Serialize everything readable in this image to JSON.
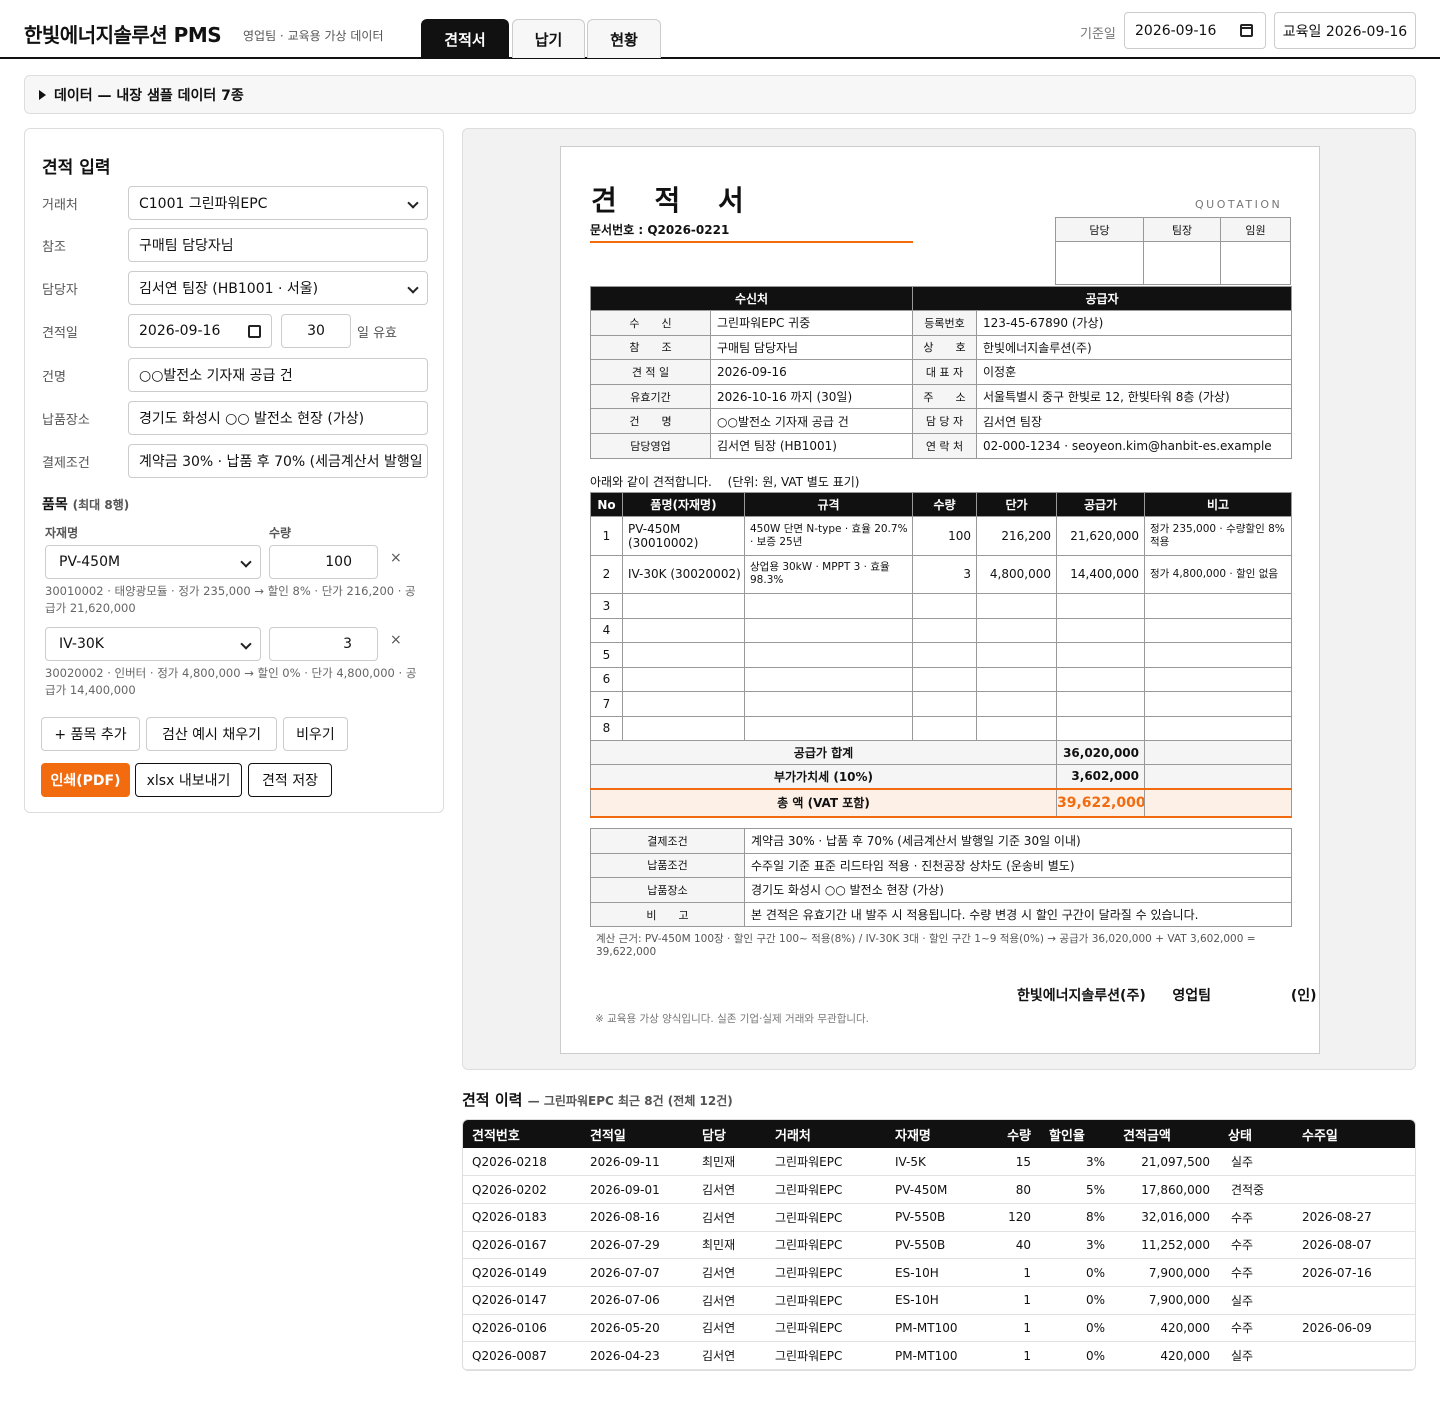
{
  "header": {
    "brand": "한빛에너지솔루션 PMS",
    "brand_sub": "영업팀 · 교육용 가상 데이터",
    "tabs": [
      "견적서",
      "납기",
      "현황"
    ],
    "base_date_label": "기준일",
    "base_date": "2026-09-16",
    "edu_date_button": "교육일 2026-09-16"
  },
  "databar": {
    "label": "데이터 — 내장 샘플 데이터 7종"
  },
  "form": {
    "title": "견적 입력",
    "customer_label": "거래처",
    "customer": "C1001 그린파워EPC",
    "ref_label": "참조",
    "ref": "구매팀 담당자님",
    "rep_label": "담당자",
    "rep": "김서연 팀장 (HB1001 · 서울)",
    "date_label": "견적일",
    "date": "2026-09-16",
    "valid_days": "30",
    "valid_suffix": "일 유효",
    "subject_label": "건명",
    "subject": "○○발전소 기자재 공급 건",
    "delivery_label": "납품장소",
    "delivery": "경기도 화성시 ○○ 발전소 현장 (가상)",
    "payment_label": "결제조건",
    "payment": "계약금 30% · 납품 후 70% (세금계산서 발행일 기준 30일 이내)",
    "items_title": "품목",
    "items_note": "(최대 8행)",
    "col_material": "자재명",
    "col_qty": "수량",
    "items": [
      {
        "name": "PV-450M",
        "qty": "100",
        "meta": "30010002 · 태양광모듈 · 정가 235,000 → 할인 8% · 단가 216,200 · 공급가 21,620,000"
      },
      {
        "name": "IV-30K",
        "qty": "3",
        "meta": "30020002 · 인버터 · 정가 4,800,000 → 할인 0% · 단가 4,800,000 · 공급가 14,400,000"
      }
    ],
    "remove_glyph": "×",
    "add_button": "+ 품목 추가",
    "sample_button": "검산 예시 채우기",
    "clear_button": "비우기",
    "print_button": "인쇄(PDF)",
    "export_button": "xlsx 내보내기",
    "save_button": "견적 저장"
  },
  "quote": {
    "title": "견 적 서",
    "title_en": "QUOTATION",
    "doc_no": "문서번호 : Q2026-0221",
    "approval": [
      "담당",
      "팀장",
      "임원"
    ],
    "recipient_header": "수신처",
    "supplier_header": "공급자",
    "recipient": [
      {
        "label": "수　　신",
        "value": "그린파워EPC 귀중"
      },
      {
        "label": "참　　조",
        "value": "구매팀 담당자님"
      },
      {
        "label": "견 적 일",
        "value": "2026-09-16"
      },
      {
        "label": "유효기간",
        "value": "2026-10-16 까지 (30일)"
      },
      {
        "label": "건　　명",
        "value": "○○발전소 기자재 공급 건"
      },
      {
        "label": "담당영업",
        "value": "김서연 팀장 (HB1001)"
      }
    ],
    "supplier": [
      {
        "label": "등록번호",
        "value": "123-45-67890 (가상)"
      },
      {
        "label": "상　　호",
        "value": "한빛에너지솔루션(주)"
      },
      {
        "label": "대 표 자",
        "value": "이정훈"
      },
      {
        "label": "주　　소",
        "value": "서울특별시 중구 한빛로 12, 한빛타워 8층 (가상)"
      },
      {
        "label": "담 당 자",
        "value": "김서연 팀장"
      },
      {
        "label": "연 락 처",
        "value": "02-000-1234 · seoyeon.kim@hanbit-es.example"
      }
    ],
    "intro": "아래와 같이 견적합니다.　 (단위: 원, VAT 별도 표기)",
    "item_headers": [
      "No",
      "품명(자재명)",
      "규격",
      "수량",
      "단가",
      "공급가",
      "비고"
    ],
    "items": [
      {
        "no": "1",
        "name": "PV-450M (30010002)",
        "spec": "450W 단면 N-type · 효율 20.7% · 보증 25년",
        "qty": "100",
        "price": "216,200",
        "amount": "21,620,000",
        "note": "정가 235,000 · 수량할인 8% 적용"
      },
      {
        "no": "2",
        "name": "IV-30K (30020002)",
        "spec": "상업용 30kW · MPPT 3 · 효율 98.3%",
        "qty": "3",
        "price": "4,800,000",
        "amount": "14,400,000",
        "note": "정가 4,800,000 · 할인 없음"
      },
      {
        "no": "3",
        "name": "",
        "spec": "",
        "qty": "",
        "price": "",
        "amount": "",
        "note": ""
      },
      {
        "no": "4",
        "name": "",
        "spec": "",
        "qty": "",
        "price": "",
        "amount": "",
        "note": ""
      },
      {
        "no": "5",
        "name": "",
        "spec": "",
        "qty": "",
        "price": "",
        "amount": "",
        "note": ""
      },
      {
        "no": "6",
        "name": "",
        "spec": "",
        "qty": "",
        "price": "",
        "amount": "",
        "note": ""
      },
      {
        "no": "7",
        "name": "",
        "spec": "",
        "qty": "",
        "price": "",
        "amount": "",
        "note": ""
      },
      {
        "no": "8",
        "name": "",
        "spec": "",
        "qty": "",
        "price": "",
        "amount": "",
        "note": ""
      }
    ],
    "subtotal_label": "공급가 합계",
    "subtotal": "36,020,000",
    "vat_label": "부가가치세 (10%)",
    "vat": "3,602,000",
    "total_label": "총 액 (VAT 포함)",
    "total": "39,622,000",
    "terms": [
      {
        "label": "결제조건",
        "value": "계약금 30% · 납품 후 70% (세금계산서 발행일 기준 30일 이내)"
      },
      {
        "label": "납품조건",
        "value": "수주일 기준 표준 리드타임 적용 · 진천공장 상차도 (운송비 별도)"
      },
      {
        "label": "납품장소",
        "value": "경기도 화성시 ○○ 발전소 현장 (가상)"
      },
      {
        "label": "비　　고",
        "value": "본 견적은 유효기간 내 발주 시 적용됩니다. 수량 변경 시 할인 구간이 달라질 수 있습니다."
      }
    ],
    "calc_note": "계산 근거: PV-450M 100장 · 할인 구간 100~ 적용(8%) / IV-30K 3대 · 할인 구간 1~9 적용(0%) → 공급가 36,020,000 + VAT 3,602,000 = 39,622,000",
    "sign_company": "한빛에너지솔루션(주)",
    "sign_team": "영업팀",
    "sign_seal": "(인)",
    "disclaimer": "※ 교육용 가상 양식입니다. 실존 기업·실제 거래와 무관합니다."
  },
  "history": {
    "title": "견적 이력",
    "subtitle": "— 그린파워EPC 최근 8건 (전체 12건)",
    "headers": [
      "견적번호",
      "견적일",
      "담당",
      "거래처",
      "자재명",
      "수량",
      "할인율",
      "견적금액",
      "상태",
      "수주일"
    ],
    "rows": [
      [
        "Q2026-0218",
        "2026-09-11",
        "최민재",
        "그린파워EPC",
        "IV-5K",
        "15",
        "3%",
        "21,097,500",
        "실주",
        ""
      ],
      [
        "Q2026-0202",
        "2026-09-01",
        "김서연",
        "그린파워EPC",
        "PV-450M",
        "80",
        "5%",
        "17,860,000",
        "견적중",
        ""
      ],
      [
        "Q2026-0183",
        "2026-08-16",
        "김서연",
        "그린파워EPC",
        "PV-550B",
        "120",
        "8%",
        "32,016,000",
        "수주",
        "2026-08-27"
      ],
      [
        "Q2026-0167",
        "2026-07-29",
        "최민재",
        "그린파워EPC",
        "PV-550B",
        "40",
        "3%",
        "11,252,000",
        "수주",
        "2026-08-07"
      ],
      [
        "Q2026-0149",
        "2026-07-07",
        "김서연",
        "그린파워EPC",
        "ES-10H",
        "1",
        "0%",
        "7,900,000",
        "수주",
        "2026-07-16"
      ],
      [
        "Q2026-0147",
        "2026-07-06",
        "김서연",
        "그린파워EPC",
        "ES-10H",
        "1",
        "0%",
        "7,900,000",
        "실주",
        ""
      ],
      [
        "Q2026-0106",
        "2026-05-20",
        "김서연",
        "그린파워EPC",
        "PM-MT100",
        "1",
        "0%",
        "420,000",
        "수주",
        "2026-06-09"
      ],
      [
        "Q2026-0087",
        "2026-04-23",
        "김서연",
        "그린파워EPC",
        "PM-MT100",
        "1",
        "0%",
        "420,000",
        "실주",
        ""
      ]
    ]
  },
  "colors": {
    "accent": "#f26b0f",
    "dark": "#111111",
    "border": "#dddddd"
  }
}
